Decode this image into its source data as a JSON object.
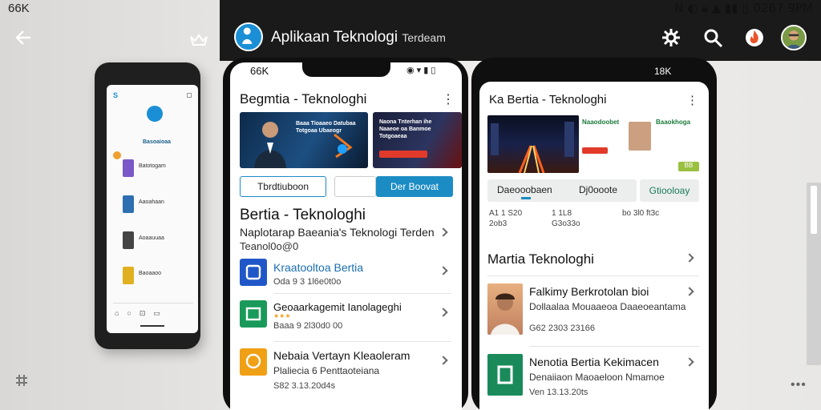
{
  "overlay": {
    "corner_label": "66K"
  },
  "status_bar": {
    "time": "0267 9PM"
  },
  "header": {
    "title": "Aplikaan Teknologi",
    "title_small": "Terdeam"
  },
  "left_phone": {
    "logo_letter": "S",
    "brand": "Basoaioaa",
    "items": [
      "Batotogam",
      "Aaoahaan",
      "Aoaauuaa",
      "Baoaaoo"
    ]
  },
  "mid_phone": {
    "status_label": "66K",
    "app_title": "Begmtia - Teknologhi",
    "banner1_text": "Baaa Tioaaeo Datubaa Totgoaa Ubaeogr",
    "banner2_text": "Naona Tnterhan ihe Naaeoe oa Banmoe Totgoaeaa",
    "button_outline": "Tbrdtiuboon",
    "button_filled": "Der Boovat",
    "section_title": "Bertia - Teknologhi",
    "section_sub": "Naplotarap Baeania's Teknologi Terden",
    "section_sub2": "Teanol0o@0",
    "items": [
      {
        "title": "Kraatooltoa Bertia",
        "meta": "Oda 9 3 1l6e0t0o"
      },
      {
        "title": "Geoaarkagemit Ianolageghi",
        "meta": "Baaa 9 2l30d0 00"
      },
      {
        "title": "Nebaia Vertayn Kleaoleram",
        "meta": "Plaliecia 6 Penttaoteiana",
        "meta2": "S82 3.13.20d4s"
      }
    ]
  },
  "right_phone": {
    "status_label": "18K",
    "app_title": "Ka Bertia - Teknologhi",
    "card2_text": "Naaodoobet",
    "card3_text": "Baaokhoga",
    "badge": "BB",
    "tabs": [
      "Daeooobaen",
      "Dj0ooote",
      "Gtiooloay"
    ],
    "stats": [
      "A1 1 S20 2ob3",
      "1 1L8 G3o33o",
      "bo 3l0 ft3c"
    ],
    "section_title": "Martia Teknologhi",
    "items": [
      {
        "title": "Falkimy Berkrotolan bioi",
        "meta": "Dollaalaa Mouaaeoa Daaeoeantama",
        "meta2": "G62 2303 23166"
      },
      {
        "title": "Nenotia Bertia Kekimacen",
        "meta": "Denaiiaon Maoaeloon Nmamoe",
        "meta2": "Ven 13.13.20ts"
      }
    ]
  },
  "colors": {
    "header_bg": "#1a1a1a",
    "accent": "#1b8fd6",
    "button_fill": "#1c8cc4"
  }
}
